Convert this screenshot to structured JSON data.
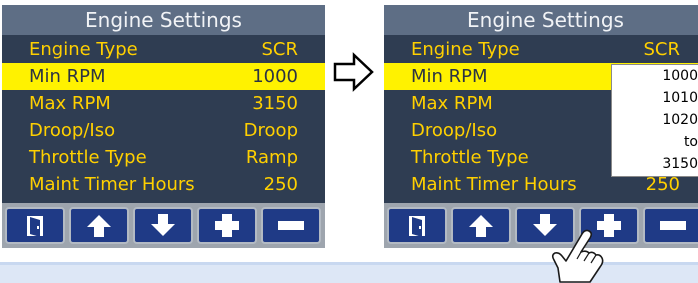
{
  "left_screen": {
    "title": "Engine Settings",
    "rows": [
      {
        "label": "Engine Type",
        "value": "SCR",
        "selected": false
      },
      {
        "label": "Min RPM",
        "value": "1000",
        "selected": true
      },
      {
        "label": "Max RPM",
        "value": "3150",
        "selected": false
      },
      {
        "label": "Droop/Iso",
        "value": "Droop",
        "selected": false
      },
      {
        "label": "Throttle Type",
        "value": "Ramp",
        "selected": false
      },
      {
        "label": "Maint Timer Hours",
        "value": "250",
        "selected": false
      }
    ],
    "softkeys": [
      "door-icon",
      "up-arrow-icon",
      "down-arrow-icon",
      "plus-icon",
      "minus-icon"
    ]
  },
  "right_screen": {
    "title": "Engine Settings",
    "rows": [
      {
        "label": "Engine Type",
        "value": "SCR",
        "selected": false
      },
      {
        "label": "Min RPM",
        "value": "",
        "selected": true
      },
      {
        "label": "Max RPM",
        "value": "",
        "selected": false
      },
      {
        "label": "Droop/Iso",
        "value": "",
        "selected": false
      },
      {
        "label": "Throttle Type",
        "value": "",
        "selected": false
      },
      {
        "label": "Maint Timer Hours",
        "value": "250",
        "selected": false
      }
    ],
    "dropdown_options": [
      "1000",
      "1010",
      "1020",
      "to",
      "3150"
    ],
    "softkeys": [
      "door-icon",
      "up-arrow-icon",
      "down-arrow-icon",
      "plus-icon",
      "minus-icon"
    ],
    "pressed_key": "plus-icon"
  },
  "icons": {
    "flow_arrow": "right-arrow-outline-icon",
    "cursor": "pointing-hand-icon"
  },
  "colors": {
    "screen_bg": "#2f3d52",
    "title_bar": "#5e6e85",
    "label_text": "#ffd000",
    "highlight_row": "#fff200",
    "key_face": "#1f3a86",
    "key_bar": "#9ea5ae"
  }
}
